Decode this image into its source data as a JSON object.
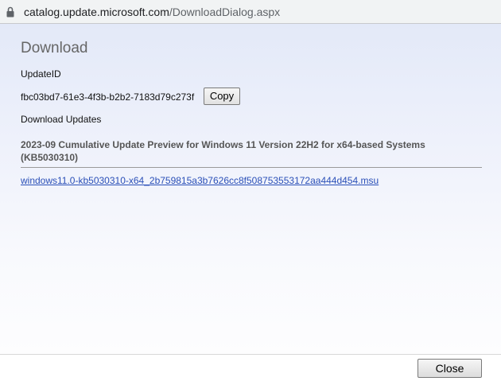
{
  "address_bar": {
    "lock_icon": "lock-icon",
    "url_host": "catalog.update.microsoft.com",
    "url_path": "/DownloadDialog.aspx"
  },
  "dialog": {
    "title": "Download",
    "update_id_label": "UpdateID",
    "update_id_value": "fbc03bd7-61e3-4f3b-b2b2-7183d79c273f",
    "copy_label": "Copy",
    "download_updates_label": "Download Updates",
    "update_title": "2023-09 Cumulative Update Preview for Windows 11 Version 22H2 for x64-based Systems (KB5030310)",
    "download_link": "windows11.0-kb5030310-x64_2b759815a3b7626cc8f508753553172aa444d454.msu"
  },
  "footer": {
    "close_label": "Close"
  },
  "colors": {
    "link": "#2a4fb8",
    "title_gray": "#666666",
    "background_top": "#e3e9f8"
  }
}
